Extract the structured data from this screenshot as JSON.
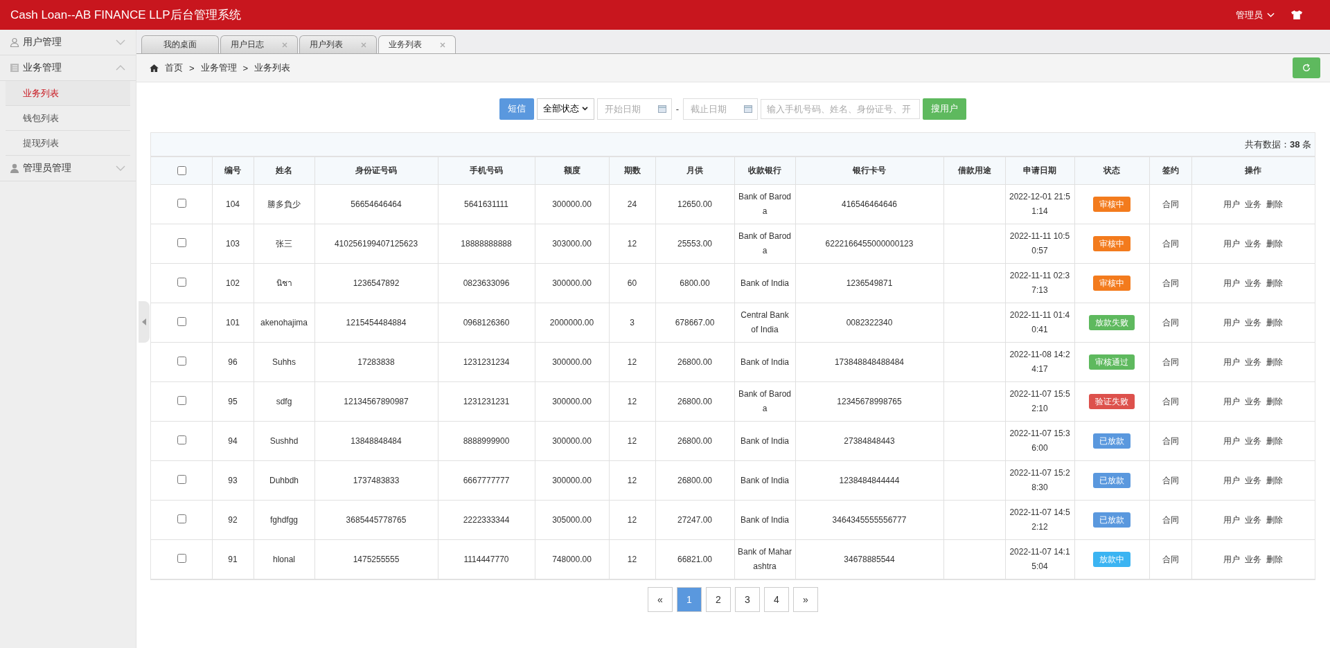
{
  "header": {
    "title": "Cash Loan--AB FINANCE LLP后台管理系统",
    "user": "管理员"
  },
  "sidebar": [
    {
      "label": "用户管理",
      "expanded": false
    },
    {
      "label": "业务管理",
      "expanded": true,
      "children": [
        {
          "label": "业务列表",
          "selected": true
        },
        {
          "label": "钱包列表",
          "selected": false
        },
        {
          "label": "提现列表",
          "selected": false
        }
      ]
    },
    {
      "label": "管理员管理",
      "expanded": false
    }
  ],
  "tabs": [
    {
      "label": "我的桌面",
      "selected": false,
      "closable": false
    },
    {
      "label": "用户日志",
      "selected": false,
      "closable": true
    },
    {
      "label": "用户列表",
      "selected": false,
      "closable": true
    },
    {
      "label": "业务列表",
      "selected": true,
      "closable": true
    }
  ],
  "breadcrumb": {
    "separator": ">",
    "items": [
      "首页",
      "业务管理",
      "业务列表"
    ]
  },
  "toolbar": {
    "sms_button": "短信",
    "status_select": "全部状态",
    "start_date": {
      "placeholder": "开始日期"
    },
    "separator": "-",
    "end_date": {
      "placeholder": "截止日期"
    },
    "search": {
      "placeholder": "输入手机号码、姓名、身份证号、开"
    },
    "search_button": "搜用户"
  },
  "table": {
    "summary": "共有数据：**38** 条",
    "select_all_checked": false,
    "columns": [
      "编号",
      "姓名",
      "身份证号码",
      "手机号码",
      "额度",
      "期数",
      "月供",
      "收款银行",
      "银行卡号",
      "借款用途",
      "申请日期",
      "状态",
      "签约",
      "操作"
    ],
    "rows": [
      {
        "checked": false,
        "id": "104",
        "name": "勝多負少",
        "id_number": "56654646464",
        "phone": "5641631111",
        "amount": "300000.00",
        "term": "24",
        "monthly": "12650.00",
        "bank": "Bank of Baroda",
        "card": "416546464646",
        "date": "2022-12-01 21:51:14",
        "status": {
          "label": "审核中",
          "color": "#f37b1d"
        },
        "contract": "合同",
        "actions": [
          "用户",
          "业务",
          "删除"
        ]
      },
      {
        "checked": false,
        "id": "103",
        "name": "张三",
        "id_number": "410256199407125623",
        "phone": "18888888888",
        "amount": "303000.00",
        "term": "12",
        "monthly": "25553.00",
        "bank": "Bank of Baroda",
        "card": "6222166455000000123",
        "date": "2022-11-11 10:50:57",
        "status": {
          "label": "审核中",
          "color": "#f37b1d"
        },
        "contract": "合同",
        "actions": [
          "用户",
          "业务",
          "删除"
        ]
      },
      {
        "checked": false,
        "id": "102",
        "name": "นิชา",
        "id_number": "1236547892",
        "phone": "0823633096",
        "amount": "300000.00",
        "term": "60",
        "monthly": "6800.00",
        "bank": "Bank of India",
        "card": "1236549871",
        "date": "2022-11-11 02:37:13",
        "status": {
          "label": "审核中",
          "color": "#f37b1d"
        },
        "contract": "合同",
        "actions": [
          "用户",
          "业务",
          "删除"
        ]
      },
      {
        "checked": false,
        "id": "101",
        "name": "akenohajima",
        "id_number": "1215454484884",
        "phone": "0968126360",
        "amount": "2000000.00",
        "term": "3",
        "monthly": "678667.00",
        "bank": "Central Bank of India",
        "card": "0082322340",
        "date": "2022-11-11 01:40:41",
        "status": {
          "label": "放款失败",
          "color": "#5eb95e"
        },
        "contract": "合同",
        "actions": [
          "用户",
          "业务",
          "删除"
        ]
      },
      {
        "checked": false,
        "id": "96",
        "name": "Suhhs",
        "id_number": "17283838",
        "phone": "1231231234",
        "amount": "300000.00",
        "term": "12",
        "monthly": "26800.00",
        "bank": "Bank of India",
        "card": "173848848488484",
        "date": "2022-11-08 14:24:17",
        "status": {
          "label": "审核通过",
          "color": "#5eb95e"
        },
        "contract": "合同",
        "actions": [
          "用户",
          "业务",
          "删除"
        ]
      },
      {
        "checked": false,
        "id": "95",
        "name": "sdfg",
        "id_number": "12134567890987",
        "phone": "1231231231",
        "amount": "300000.00",
        "term": "12",
        "monthly": "26800.00",
        "bank": "Bank of Baroda",
        "card": "12345678998765",
        "date": "2022-11-07 15:52:10",
        "status": {
          "label": "验证失败",
          "color": "#dd514c"
        },
        "contract": "合同",
        "actions": [
          "用户",
          "业务",
          "删除"
        ]
      },
      {
        "checked": false,
        "id": "94",
        "name": "Sushhd",
        "id_number": "13848848484",
        "phone": "8888999900",
        "amount": "300000.00",
        "term": "12",
        "monthly": "26800.00",
        "bank": "Bank of India",
        "card": "27384848443",
        "date": "2022-11-07 15:36:00",
        "status": {
          "label": "已放款",
          "color": "#5a98de"
        },
        "contract": "合同",
        "actions": [
          "用户",
          "业务",
          "删除"
        ]
      },
      {
        "checked": false,
        "id": "93",
        "name": "Duhbdh",
        "id_number": "1737483833",
        "phone": "6667777777",
        "amount": "300000.00",
        "term": "12",
        "monthly": "26800.00",
        "bank": "Bank of India",
        "card": "1238484844444",
        "date": "2022-11-07 15:28:30",
        "status": {
          "label": "已放款",
          "color": "#5a98de"
        },
        "contract": "合同",
        "actions": [
          "用户",
          "业务",
          "删除"
        ]
      },
      {
        "checked": false,
        "id": "92",
        "name": "fghdfgg",
        "id_number": "3685445778765",
        "phone": "2222333344",
        "amount": "305000.00",
        "term": "12",
        "monthly": "27247.00",
        "bank": "Bank of India",
        "card": "3464345555556777",
        "date": "2022-11-07 14:52:12",
        "status": {
          "label": "已放款",
          "color": "#5a98de"
        },
        "contract": "合同",
        "actions": [
          "用户",
          "业务",
          "删除"
        ]
      },
      {
        "checked": false,
        "id": "91",
        "name": "hlonal",
        "id_number": "1475255555",
        "phone": "1114447770",
        "amount": "748000.00",
        "term": "12",
        "monthly": "66821.00",
        "bank": "Bank of Maharashtra",
        "card": "34678885544",
        "date": "2022-11-07 14:15:04",
        "status": {
          "label": "放款中",
          "color": "#3bb4f2"
        },
        "contract": "合同",
        "actions": [
          "用户",
          "业务",
          "删除"
        ]
      }
    ]
  },
  "pagination": {
    "prev": "«",
    "next": "»",
    "pages": [
      {
        "label": "1",
        "selected": true
      },
      {
        "label": "2",
        "selected": false
      },
      {
        "label": "3",
        "selected": false
      },
      {
        "label": "4",
        "selected": false
      }
    ]
  }
}
